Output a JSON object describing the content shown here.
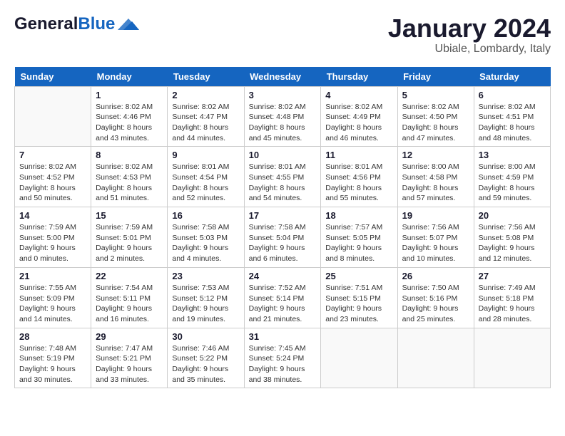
{
  "header": {
    "logo_general": "General",
    "logo_blue": "Blue",
    "month_title": "January 2024",
    "location": "Ubiale, Lombardy, Italy"
  },
  "days_of_week": [
    "Sunday",
    "Monday",
    "Tuesday",
    "Wednesday",
    "Thursday",
    "Friday",
    "Saturday"
  ],
  "weeks": [
    [
      {
        "day": "",
        "info": ""
      },
      {
        "day": "1",
        "info": "Sunrise: 8:02 AM\nSunset: 4:46 PM\nDaylight: 8 hours\nand 43 minutes."
      },
      {
        "day": "2",
        "info": "Sunrise: 8:02 AM\nSunset: 4:47 PM\nDaylight: 8 hours\nand 44 minutes."
      },
      {
        "day": "3",
        "info": "Sunrise: 8:02 AM\nSunset: 4:48 PM\nDaylight: 8 hours\nand 45 minutes."
      },
      {
        "day": "4",
        "info": "Sunrise: 8:02 AM\nSunset: 4:49 PM\nDaylight: 8 hours\nand 46 minutes."
      },
      {
        "day": "5",
        "info": "Sunrise: 8:02 AM\nSunset: 4:50 PM\nDaylight: 8 hours\nand 47 minutes."
      },
      {
        "day": "6",
        "info": "Sunrise: 8:02 AM\nSunset: 4:51 PM\nDaylight: 8 hours\nand 48 minutes."
      }
    ],
    [
      {
        "day": "7",
        "info": "Sunrise: 8:02 AM\nSunset: 4:52 PM\nDaylight: 8 hours\nand 50 minutes."
      },
      {
        "day": "8",
        "info": "Sunrise: 8:02 AM\nSunset: 4:53 PM\nDaylight: 8 hours\nand 51 minutes."
      },
      {
        "day": "9",
        "info": "Sunrise: 8:01 AM\nSunset: 4:54 PM\nDaylight: 8 hours\nand 52 minutes."
      },
      {
        "day": "10",
        "info": "Sunrise: 8:01 AM\nSunset: 4:55 PM\nDaylight: 8 hours\nand 54 minutes."
      },
      {
        "day": "11",
        "info": "Sunrise: 8:01 AM\nSunset: 4:56 PM\nDaylight: 8 hours\nand 55 minutes."
      },
      {
        "day": "12",
        "info": "Sunrise: 8:00 AM\nSunset: 4:58 PM\nDaylight: 8 hours\nand 57 minutes."
      },
      {
        "day": "13",
        "info": "Sunrise: 8:00 AM\nSunset: 4:59 PM\nDaylight: 8 hours\nand 59 minutes."
      }
    ],
    [
      {
        "day": "14",
        "info": "Sunrise: 7:59 AM\nSunset: 5:00 PM\nDaylight: 9 hours\nand 0 minutes."
      },
      {
        "day": "15",
        "info": "Sunrise: 7:59 AM\nSunset: 5:01 PM\nDaylight: 9 hours\nand 2 minutes."
      },
      {
        "day": "16",
        "info": "Sunrise: 7:58 AM\nSunset: 5:03 PM\nDaylight: 9 hours\nand 4 minutes."
      },
      {
        "day": "17",
        "info": "Sunrise: 7:58 AM\nSunset: 5:04 PM\nDaylight: 9 hours\nand 6 minutes."
      },
      {
        "day": "18",
        "info": "Sunrise: 7:57 AM\nSunset: 5:05 PM\nDaylight: 9 hours\nand 8 minutes."
      },
      {
        "day": "19",
        "info": "Sunrise: 7:56 AM\nSunset: 5:07 PM\nDaylight: 9 hours\nand 10 minutes."
      },
      {
        "day": "20",
        "info": "Sunrise: 7:56 AM\nSunset: 5:08 PM\nDaylight: 9 hours\nand 12 minutes."
      }
    ],
    [
      {
        "day": "21",
        "info": "Sunrise: 7:55 AM\nSunset: 5:09 PM\nDaylight: 9 hours\nand 14 minutes."
      },
      {
        "day": "22",
        "info": "Sunrise: 7:54 AM\nSunset: 5:11 PM\nDaylight: 9 hours\nand 16 minutes."
      },
      {
        "day": "23",
        "info": "Sunrise: 7:53 AM\nSunset: 5:12 PM\nDaylight: 9 hours\nand 19 minutes."
      },
      {
        "day": "24",
        "info": "Sunrise: 7:52 AM\nSunset: 5:14 PM\nDaylight: 9 hours\nand 21 minutes."
      },
      {
        "day": "25",
        "info": "Sunrise: 7:51 AM\nSunset: 5:15 PM\nDaylight: 9 hours\nand 23 minutes."
      },
      {
        "day": "26",
        "info": "Sunrise: 7:50 AM\nSunset: 5:16 PM\nDaylight: 9 hours\nand 25 minutes."
      },
      {
        "day": "27",
        "info": "Sunrise: 7:49 AM\nSunset: 5:18 PM\nDaylight: 9 hours\nand 28 minutes."
      }
    ],
    [
      {
        "day": "28",
        "info": "Sunrise: 7:48 AM\nSunset: 5:19 PM\nDaylight: 9 hours\nand 30 minutes."
      },
      {
        "day": "29",
        "info": "Sunrise: 7:47 AM\nSunset: 5:21 PM\nDaylight: 9 hours\nand 33 minutes."
      },
      {
        "day": "30",
        "info": "Sunrise: 7:46 AM\nSunset: 5:22 PM\nDaylight: 9 hours\nand 35 minutes."
      },
      {
        "day": "31",
        "info": "Sunrise: 7:45 AM\nSunset: 5:24 PM\nDaylight: 9 hours\nand 38 minutes."
      },
      {
        "day": "",
        "info": ""
      },
      {
        "day": "",
        "info": ""
      },
      {
        "day": "",
        "info": ""
      }
    ]
  ]
}
